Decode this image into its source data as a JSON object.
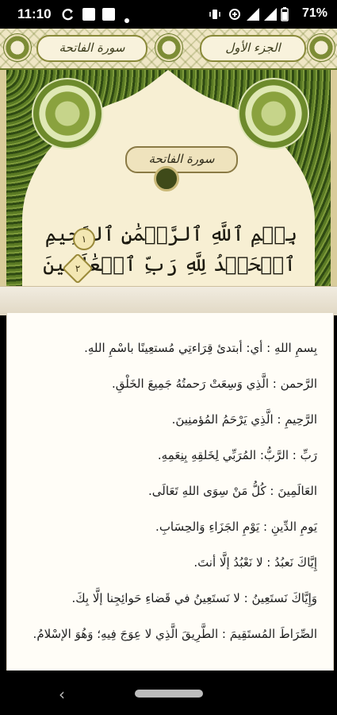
{
  "status_bar": {
    "time": "11:10",
    "battery_percent": "71%"
  },
  "header": {
    "juz_label": "الجزء الأول",
    "surah_label": "سورة الفاتحة"
  },
  "mushaf": {
    "surah_title": "سورة الفاتحة",
    "verses": [
      {
        "text": "بِسۡمِ ٱللَّهِ ٱلرَّحۡمَٰنِ ٱلرَّحِيمِ",
        "number": "١"
      },
      {
        "text": "ٱلۡحَمۡدُ لِلَّهِ رَبِّ ٱلۡعَٰلَمِينَ",
        "number": "٢"
      }
    ]
  },
  "tafsir": {
    "lines": [
      "بِسمِ اللهِ : أي: أبتدئ قِرَاءتِي مُستعِينًا باسْمِ اللهِ.",
      "الرَّحمن : الَّذِي وَسِعَتْ رَحمتُهُ جَمِيعَ الخَلْقِ.",
      "الرَّحِيمِ : الَّذِي يَرْحَمُ المُؤمنِينَ.",
      "رَبِّ : الرَّبُّ: المُرَبِّي لِخَلقِهِ بِنِعَمِهِ.",
      "العَالَمِينَ : كُلُّ مَنْ سِوَى اللهِ تَعَالَى.",
      "يَومِ الدِّينِ : يَوْمِ الجَزَاءِ وَالحِسَابِ.",
      "إِيَّاكَ نَعبُدُ : لا نَعْبُدُ إلَّا أنتَ.",
      "وَإِيَّاكَ نَستَعِينُ : لا نَستَعِينُ في قَضاءِ حَوائِجِنا إلَّا بِكَ.",
      "الصِّرَاطَ المُستَقِيمَ : الطَّرِيقَ الَّذِي لا عِوَجَ فِيهِ؛ وَهُوَ الإسْلامُ."
    ]
  }
}
